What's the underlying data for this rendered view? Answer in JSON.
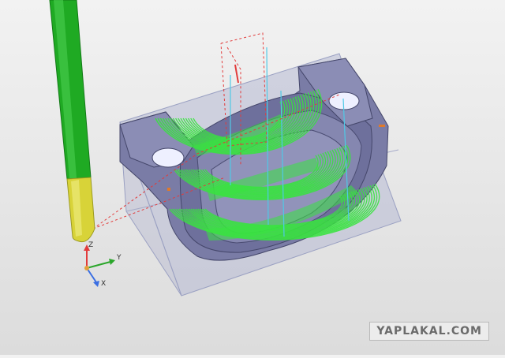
{
  "scene": {
    "colors": {
      "background_top": "#f2f2f2",
      "background_bottom": "#dcdcdc",
      "part": "#7a7ca6",
      "part_dark": "#5e6088",
      "stock_box": "#b6b9d4",
      "toolpath": "#39e33f",
      "tool_shank": "#1faa23",
      "tool_tip": "#d8d338",
      "rapid_move": "#e23b3b",
      "link_move": "#4fc9e6"
    },
    "icons": [
      "axis-triad-icon"
    ]
  },
  "axis": {
    "z_label": "Z",
    "y_label": "Y",
    "x_label": "X"
  },
  "watermark": {
    "text": "YAPLAKAL.COM"
  }
}
